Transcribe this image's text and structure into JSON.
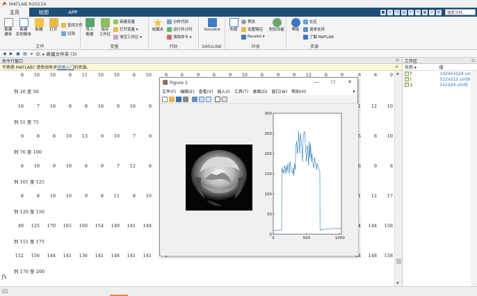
{
  "window": {
    "title": "MATLAB R2021b"
  },
  "ribbon_tabs": [
    {
      "label": "主页",
      "active": true
    },
    {
      "label": "绘图",
      "active": false
    },
    {
      "label": "APP",
      "active": false
    }
  ],
  "search_docs": "搜索文档",
  "ribbon": {
    "file": {
      "label": "文件",
      "new_script": "新建\n脚本",
      "new_live_script": "新建\n实时脚本",
      "new": "新建",
      "open": "打开",
      "find_files": "查找文件",
      "compare": "比较"
    },
    "variable": {
      "label": "变量",
      "import_data": "导入\n数据",
      "save_workspace": "保存\n工作区",
      "new_variable": "新建变量",
      "open_variable": "打开变量 ▾",
      "clear_workspace": "清空工作区 ▾"
    },
    "code": {
      "label": "代码",
      "favorites": "收藏夹",
      "analyze_code": "分析代码",
      "run_and_time": "运行并计时",
      "clear_commands": "清除命令 ▾"
    },
    "simulink": {
      "label": "SIMULINK",
      "simulink": "Simulink"
    },
    "environment": {
      "label": "环境",
      "layout": "布局",
      "preferences": "预设",
      "set_path": "设置路径",
      "parallel": "Parallel ▾",
      "add_ons": "附加功能"
    },
    "resources": {
      "label": "资源",
      "help": "帮助",
      "community": "社区",
      "request_support": "请求支持",
      "learn_matlab": "了解 MATLAB"
    }
  },
  "address": {
    "path": "D: ▸ 新建文件夹 (3)"
  },
  "command_window": {
    "title": "命令行窗口",
    "notice_prefix": "不熟悉 MATLAB? 请参阅有关",
    "notice_link": "快速入门",
    "notice_suffix": "的资源。",
    "lines": [
      {
        "type": "nums",
        "values": [
          "8",
          "10",
          "10",
          "8",
          "11",
          "10",
          "10",
          "8",
          "10",
          "9",
          "6",
          "9",
          "8",
          "9",
          "10",
          "8",
          "9",
          "9",
          "12",
          "8",
          "9",
          "8",
          "8",
          "9"
        ],
        "y": 0
      },
      {
        "type": "label",
        "text": "列 26 至 50",
        "y": 22
      },
      {
        "type": "nums",
        "values": [
          "10",
          "7",
          "10",
          "8",
          "8",
          "10",
          "9",
          "10",
          "9",
          "",
          "",
          "",
          "",
          "",
          "",
          "",
          "",
          "",
          "",
          "",
          "",
          "11",
          "12",
          "10"
        ],
        "y": 45
      },
      {
        "type": "label",
        "text": "列 51 至 75",
        "y": 66
      },
      {
        "type": "nums",
        "values": [
          "9",
          "8",
          "8",
          "10",
          "13",
          "9",
          "10",
          "7",
          "9",
          "",
          "",
          "",
          "",
          "",
          "",
          "",
          "",
          "",
          "",
          "",
          "",
          "5",
          "8",
          "10"
        ],
        "y": 88
      },
      {
        "type": "label",
        "text": "列 76 至 100",
        "y": 109
      },
      {
        "type": "nums",
        "values": [
          "8",
          "10",
          "9",
          "10",
          "8",
          "9",
          "7",
          "12",
          "8",
          "",
          "",
          "",
          "",
          "",
          "",
          "",
          "",
          "",
          "",
          "",
          "",
          "6",
          "9",
          "8"
        ],
        "y": 131
      },
      {
        "type": "label",
        "text": "列 101 至 125",
        "y": 152
      },
      {
        "type": "nums",
        "values": [
          "8",
          "8",
          "10",
          "10",
          "9",
          "8",
          "11",
          "8",
          "10",
          "",
          "",
          "",
          "",
          "",
          "",
          "",
          "",
          "",
          "",
          "",
          "",
          "11",
          "12",
          "17"
        ],
        "y": 174
      },
      {
        "type": "label",
        "text": "列 126 至 150",
        "y": 195
      },
      {
        "type": "nums",
        "values": [
          "49",
          "125",
          "170",
          "165",
          "160",
          "154",
          "149",
          "141",
          "144",
          "1",
          "",
          "",
          "",
          "",
          "",
          "",
          "",
          "",
          "",
          "",
          "",
          "44",
          "144",
          "158"
        ],
        "y": 217
      },
      {
        "type": "label",
        "text": "列 151 至 175",
        "y": 238
      },
      {
        "type": "nums",
        "values": [
          "152",
          "156",
          "144",
          "141",
          "136",
          "141",
          "148",
          "141",
          "141",
          "1",
          "",
          "",
          "",
          "",
          "",
          "",
          "",
          "",
          "",
          "",
          "",
          "44",
          "148",
          "158"
        ],
        "y": 260
      },
      {
        "type": "label",
        "text": "列 176 至 200",
        "y": 281
      }
    ]
  },
  "prompt_symbol": "fx",
  "workspace": {
    "title": "工作区",
    "col_name": "名称 ▾",
    "col_value": "值",
    "vars": [
      {
        "name": "f",
        "value": "1024x1024 uint8"
      },
      {
        "name": "i",
        "value": "512x512 uint8"
      },
      {
        "name": "s",
        "value": "1x1024 uint8"
      }
    ]
  },
  "figure": {
    "title": "Figure 1",
    "menu": [
      "文件(F)",
      "编辑(E)",
      "查看(V)",
      "插入(I)",
      "工具(T)",
      "桌面(D)",
      "窗口(W)",
      "帮助(H)"
    ]
  },
  "chart_data": {
    "type": "line",
    "title": "",
    "xlabel": "",
    "ylabel": "",
    "xlim": [
      0,
      1024
    ],
    "ylim": [
      0,
      300
    ],
    "xticks": [
      0,
      500,
      1000
    ],
    "yticks": [
      0,
      50,
      100,
      150,
      200,
      250,
      300
    ],
    "grid": false,
    "series": [
      {
        "color": "#1f77b4",
        "x": [
          0,
          40,
          80,
          110,
          125,
          128,
          130,
          140,
          150,
          160,
          170,
          180,
          190,
          200,
          210,
          220,
          230,
          240,
          250,
          260,
          270,
          280,
          290,
          300,
          310,
          320,
          330,
          340,
          350,
          360,
          370,
          380,
          390,
          400,
          410,
          420,
          430,
          440,
          450,
          460,
          470,
          480,
          490,
          500,
          510,
          520,
          530,
          540,
          550,
          560,
          570,
          580,
          590,
          600,
          610,
          620,
          630,
          640,
          650,
          660,
          670,
          680,
          690,
          700,
          702,
          705,
          720,
          760,
          800,
          850,
          900,
          950,
          1000,
          1024
        ],
        "y": [
          10,
          9,
          10,
          10,
          11,
          140,
          165,
          155,
          158,
          150,
          170,
          160,
          150,
          170,
          155,
          175,
          165,
          150,
          180,
          170,
          160,
          155,
          150,
          165,
          145,
          175,
          160,
          220,
          230,
          200,
          210,
          255,
          225,
          200,
          250,
          230,
          215,
          180,
          240,
          250,
          255,
          230,
          200,
          180,
          220,
          210,
          170,
          230,
          190,
          225,
          180,
          200,
          185,
          170,
          165,
          190,
          180,
          175,
          160,
          175,
          170,
          165,
          160,
          158,
          12,
          10,
          11,
          12,
          13,
          12,
          14,
          15,
          14,
          13
        ]
      }
    ]
  }
}
